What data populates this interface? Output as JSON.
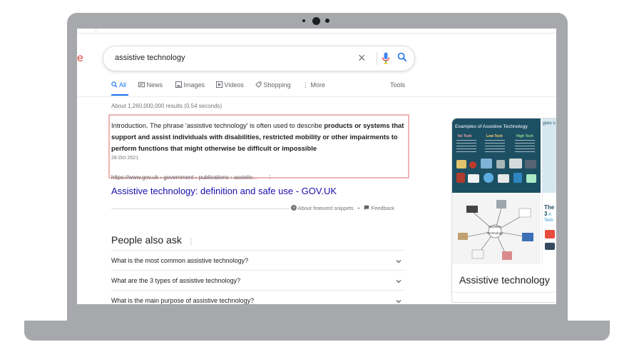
{
  "search": {
    "query": "assistive technology",
    "logo_fragment": "e"
  },
  "tabs": [
    {
      "label": "All",
      "icon": "search-icon",
      "active": true
    },
    {
      "label": "News",
      "icon": "news-icon"
    },
    {
      "label": "Images",
      "icon": "images-icon"
    },
    {
      "label": "Videos",
      "icon": "videos-icon"
    },
    {
      "label": "Shopping",
      "icon": "shopping-tag-icon"
    },
    {
      "label": "More",
      "icon": "more-vert-icon"
    }
  ],
  "tools_label": "Tools",
  "result_stats": "About 1,260,000,000 results (0.54 seconds)",
  "featured_snippet": {
    "text_plain": "Introduction. The phrase 'assistive technology' is often used to describe ",
    "text_bold": "products or systems that support and assist individuals with disabilities, restricted mobility or other impairments to perform functions that might otherwise be difficult or impossible",
    "date": "28 Oct 2021",
    "url": "https://www.gov.uk › government › publications › assistiv...",
    "title": "Assistive technology: definition and safe use - GOV.UK",
    "about_label": "About featured snippets",
    "separator": "•",
    "feedback_label": "Feedback"
  },
  "people_also_ask": {
    "heading": "People also ask",
    "questions": [
      "What is the most common assistive technology?",
      "What are the 3 types of assistive technology?",
      "What is the main purpose of assistive technology?"
    ]
  },
  "knowledge_panel": {
    "title": "Assistive technology",
    "image_caption": "Examples of Assistive Technology",
    "image_side_caption": "ypes o",
    "image_columns": [
      "No Tech",
      "Low Tech",
      "High Tech"
    ],
    "image4_text": [
      "The 3",
      "A",
      "Tech"
    ],
    "image3_labels": [
      "Assistive",
      "Technology"
    ]
  },
  "colors": {
    "accent": "#1a73e8",
    "link": "#1a0dab",
    "highlight_border": "#f0b3b3",
    "laptop": "#a7a8ab"
  }
}
